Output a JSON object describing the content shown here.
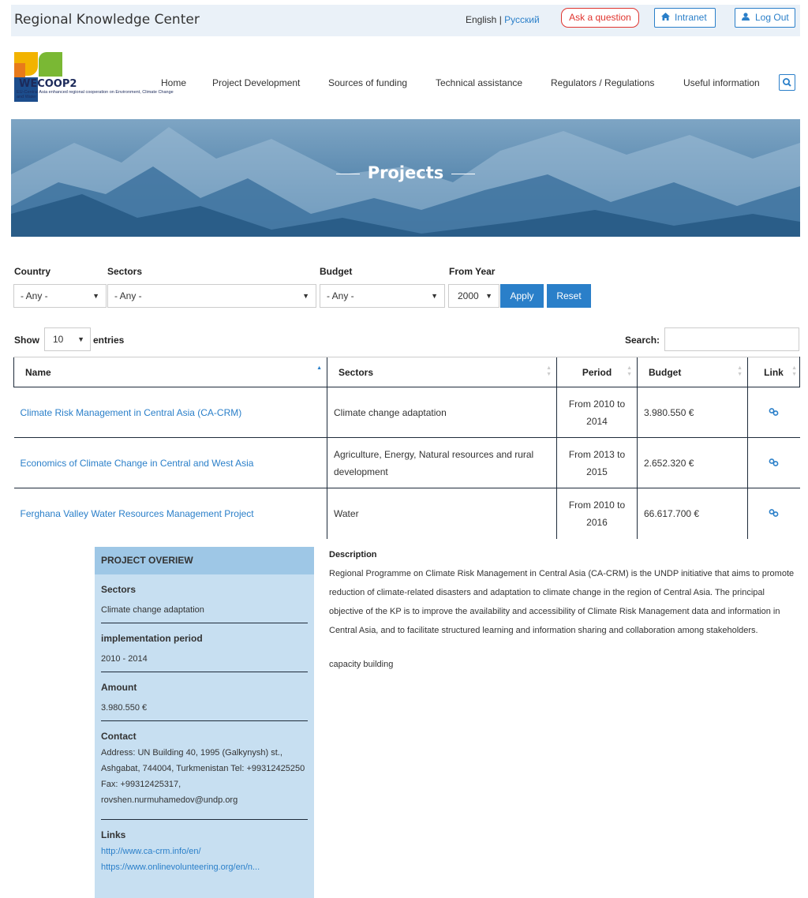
{
  "topbar": {
    "site_title": "Regional Knowledge Center",
    "lang_en": "English",
    "lang_sep": " | ",
    "lang_ru": "Русский",
    "ask_label": "Ask a question",
    "intranet_label": "Intranet",
    "logout_label": "Log Out",
    "intranet_icon": "home-icon",
    "logout_icon": "user-icon"
  },
  "logo": {
    "brand": "WECOOP2",
    "tagline": "EU-Central Asia enhanced regional cooperation on Environment, Climate Change and Water"
  },
  "nav": {
    "items": [
      "Home",
      "Project Development",
      "Sources of funding",
      "Technical assistance",
      "Regulators / Regulations",
      "Useful information"
    ],
    "search_icon": "search-icon"
  },
  "banner": {
    "title": "Projects"
  },
  "filters": {
    "country_label": "Country",
    "country_value": "- Any -",
    "sectors_label": "Sectors",
    "sectors_value": "- Any -",
    "budget_label": "Budget",
    "budget_value": "- Any -",
    "year_label": "From Year",
    "year_value": "2000",
    "apply_label": "Apply",
    "reset_label": "Reset"
  },
  "table_controls": {
    "show_label": "Show",
    "length_value": "10",
    "entries_label": "entries",
    "search_label": "Search:"
  },
  "table": {
    "headers": [
      "Name",
      "Sectors",
      "Period",
      "Budget",
      "Link"
    ],
    "rows": [
      {
        "name": "Climate Risk Management in Central Asia (CA-CRM)",
        "sectors": "Climate change adaptation",
        "period": "From 2010 to 2014",
        "budget": "3.980.550 €"
      },
      {
        "name": "Economics of Climate Change in Central and West Asia",
        "sectors": "Agriculture, Energy, Natural resources and rural development",
        "period": "From 2013 to 2015",
        "budget": "2.652.320 €"
      },
      {
        "name": "Ferghana Valley Water Resources Management Project",
        "sectors": "Water",
        "period": "From 2010 to 2016",
        "budget": "66.617.700 €"
      }
    ]
  },
  "overview": {
    "title": "PROJECT OVERIEW",
    "sectors_label": "Sectors",
    "sectors_value": "Climate change adaptation",
    "period_label": "implementation period",
    "period_value": "2010 - 2014",
    "amount_label": "Amount",
    "amount_value": "3.980.550 €",
    "contact_label": "Contact",
    "contact_value": "Address: UN Building 40, 1995 (Galkynysh) st., Ashgabat, 744004, Turkmenistan Tel: +99312425250 Fax: +99312425317, rovshen.nurmuhamedov@undp.org",
    "links_label": "Links",
    "links": [
      "http://www.ca-crm.info/en/",
      "https://www.onlinevolunteering.org/en/n..."
    ]
  },
  "description": {
    "title": "Description",
    "body": "Regional Programme on Climate Risk Management in Central Asia (CA-CRM) is the UNDP initiative that aims to promote reduction of climate-related disasters and adaptation to climate change in the region of Central Asia. The principal objective of the KP is to improve the availability and accessibility of Climate Risk Management data and information in Central Asia, and to facilitate structured learning and information sharing and collaboration among stakeholders.",
    "extra": "capacity building"
  }
}
